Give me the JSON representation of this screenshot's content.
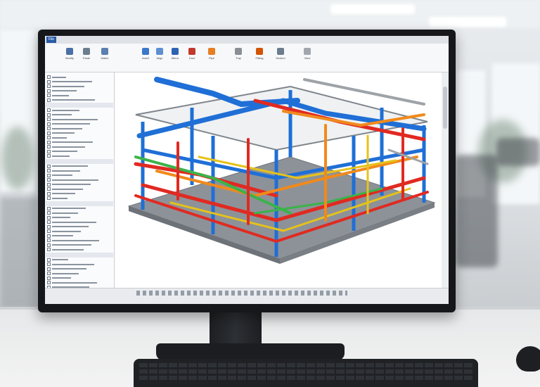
{
  "app": {
    "menu_button": "File"
  },
  "ribbon": {
    "tools": [
      {
        "label": "Modify",
        "icon": "cursor-icon",
        "color": "#4a6fa5"
      },
      {
        "label": "Paste",
        "icon": "paste-icon",
        "color": "#6d7d8f"
      },
      {
        "label": "Match",
        "icon": "match-icon",
        "color": "#5a7fb0"
      },
      {
        "label": "Insert",
        "icon": "insert-icon",
        "color": "#3b78c9"
      },
      {
        "label": "Align",
        "icon": "align-icon",
        "color": "#5f8fd1"
      },
      {
        "label": "Mirror",
        "icon": "mirror-icon",
        "color": "#2e63b4"
      },
      {
        "label": "Duct",
        "icon": "duct-icon",
        "color": "#c0392b"
      },
      {
        "label": "Pipe",
        "icon": "pipe-icon",
        "color": "#e67e22"
      },
      {
        "label": "Tray",
        "icon": "tray-icon",
        "color": "#8a8f96"
      },
      {
        "label": "Fitting",
        "icon": "fitting-icon",
        "color": "#d35400"
      },
      {
        "label": "Section",
        "icon": "section-icon",
        "color": "#6b7c8d"
      },
      {
        "label": "View",
        "icon": "view-icon",
        "color": "#a0a6ad"
      }
    ]
  },
  "colors": {
    "pipe_blue": "#1f6fd6",
    "pipe_red": "#e02a22",
    "pipe_orange": "#f08a1c",
    "pipe_yellow": "#e6c21a",
    "pipe_green": "#3bb34a",
    "slab": "#8d9298"
  }
}
